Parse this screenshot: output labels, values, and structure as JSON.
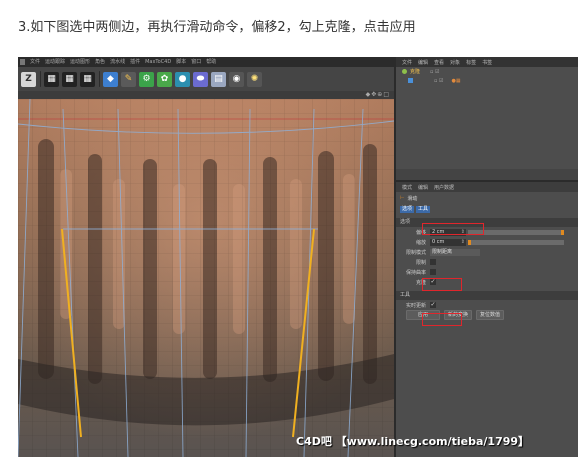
{
  "caption": "3.如下图选中两侧边，再执行滑动命令，偏移2，勾上克隆，点击应用",
  "cinema4d": {
    "menubar": [
      "文件",
      "运动跟踪",
      "运动图形",
      "角色",
      "流水线",
      "插件",
      "MaxToC4D",
      "脚本",
      "窗口",
      "帮助"
    ],
    "toolbar_icons": [
      "undo-icon",
      "clapper-icon",
      "clapper-icon",
      "clapper-icon",
      "cube-icon",
      "pen-icon",
      "gear-green-icon",
      "flower-icon",
      "sphere-icon",
      "capsule-icon",
      "grid-icon",
      "camera-icon",
      "light-icon"
    ],
    "viewport_header_icons": "◆✥⊕□",
    "object_manager": {
      "menubar": [
        "文件",
        "编辑",
        "查看",
        "对象",
        "标签",
        "书签"
      ],
      "objects": [
        {
          "name": "克隆",
          "color": "#8ec04b"
        },
        {
          "name": "",
          "color": "#4a90d9"
        }
      ]
    },
    "attribute_manager": {
      "menubar": [
        "模式",
        "编辑",
        "用户数据"
      ],
      "tool_title": "滑动",
      "tabs": [
        "选项",
        "工具"
      ],
      "section_options": "选项",
      "offset_label": "偏移",
      "offset_value": "2 cm",
      "scale_label": "缩放",
      "scale_value": "0 cm",
      "limit_mode_label": "限制模式",
      "limit_mode_value": "限制距离",
      "limit_label": "限制",
      "preserve_curvature_label": "保持曲率",
      "clone_label": "克隆",
      "clone_checked": "✓",
      "section_tools": "工具",
      "realtime_update_label": "实时更新",
      "realtime_checked": "✓",
      "apply_button": "应用",
      "new_transform_button": "新的变换",
      "reset_button": "复位数值"
    }
  },
  "watermark": "C4D吧 【www.linecg.com/tieba/1799】",
  "colors": {
    "selection_edge": "#f0b020",
    "highlight_box": "#e0262c",
    "tab_active": "#3c6aa8"
  }
}
